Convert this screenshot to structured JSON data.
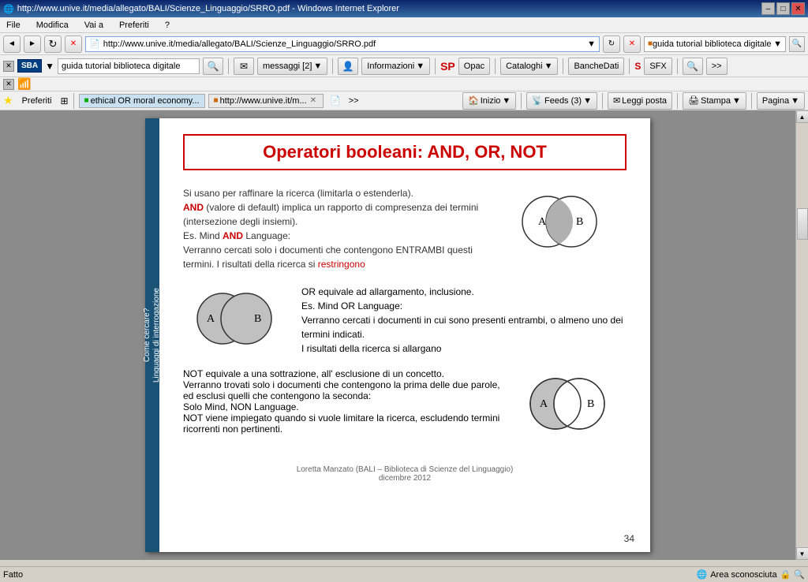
{
  "titleBar": {
    "title": "http://www.unive.it/media/allegato/BALI/Scienze_Linguaggio/SRRO.pdf - Windows Internet Explorer",
    "minimizeBtn": "–",
    "maximizeBtn": "□",
    "closeBtn": "✕"
  },
  "navBar": {
    "backBtn": "◄",
    "forwardBtn": "►",
    "refreshBtn": "↻",
    "stopBtn": "✕",
    "address": "http://www.unive.it/media/allegato/BALI/Scienze_Linguaggio/SRRO.pdf",
    "searchPlaceholder": "guida tutorial biblioteca digitale",
    "searchBtn": "🔍"
  },
  "toolbar": {
    "closeBtn": "✕",
    "sbaLabel": "SBA",
    "inputValue": "guida tutorial biblioteca digitale",
    "searchIconLabel": "🔍",
    "emailLabel": "messaggi [2]",
    "infoLabel": "Informazioni",
    "opacLabel": "Opac",
    "cataloghiLabel": "Cataloghi",
    "bancheDatiLabel": "BancheDati",
    "sfxLabel": "SFX",
    "moreBtn": ">>"
  },
  "favBar": {
    "starLabel": "★",
    "preferitiLabel": "Preferiti",
    "tab1Label": "ethical OR moral economy...",
    "tab2Label": "http://www.unive.it/m...",
    "tab2CloseBtn": "✕",
    "moreBtn": ">>",
    "inizio": "Inizio",
    "feeds": "Feeds (3)",
    "leggiPosta": "Leggi posta",
    "stampa": "Stampa",
    "pagina": "Pagina"
  },
  "pdf": {
    "pageTitle": "Operatori booleani: AND, OR, NOT",
    "sideLabel1": "Come cercare?",
    "sideLabel2": "Linguaggi di interrogazione",
    "andSection": {
      "line1": "Si usano per raffinare la ricerca (limitarla o estenderla).",
      "line2start": "AND",
      "line2rest": " (valore di default) implica un rapporto di compresenza dei termini (intersezione degli insiemi).",
      "line3": "Es. Mind ",
      "line3and": "AND",
      "line3rest": " Language:",
      "line4": "Verranno cercati solo i documenti che contengono ENTRAMBI questi termini.  I risultati della ricerca si ",
      "line4end": "restringono",
      "labelA": "A",
      "labelB": "B"
    },
    "orSection": {
      "line1start": "OR",
      "line1rest": "  equivale ad allargamento, inclusione.",
      "line2": "Es. Mind ",
      "line2or": "OR",
      "line2rest": " Language:",
      "line3": "Verranno cercati i documenti in cui sono presenti  entrambi, o almeno uno dei termini indicati.",
      "line4": "I risultati della ricerca si ",
      "line4end": "allargano",
      "labelA": "A",
      "labelB": "B"
    },
    "notSection": {
      "line1start": "NOT",
      "line1rest": " equivale a una sottrazione, all'",
      "line1bold": "esclusione",
      "line1end": " di un concetto.",
      "line2": "Verranno trovati solo i documenti che contengono la prima delle due parole, ed esclusi quelli che contengono la seconda:",
      "line3": "Solo Mind, NON Language.",
      "line4": "NOT viene impiegato quando si vuole limitare la ricerca, escludendo termini ricorrenti non pertinenti.",
      "labelA": "A",
      "labelB": "B"
    },
    "footer": {
      "line1": "Loretta Manzato (BALI – Biblioteca di Scienze del Linguaggio)",
      "line2": "dicembre 2012",
      "pageNum": "34"
    }
  },
  "statusBar": {
    "statusText": "Fatto",
    "zoneText": "Area sconosciuta",
    "lockIcon": "🔒"
  }
}
